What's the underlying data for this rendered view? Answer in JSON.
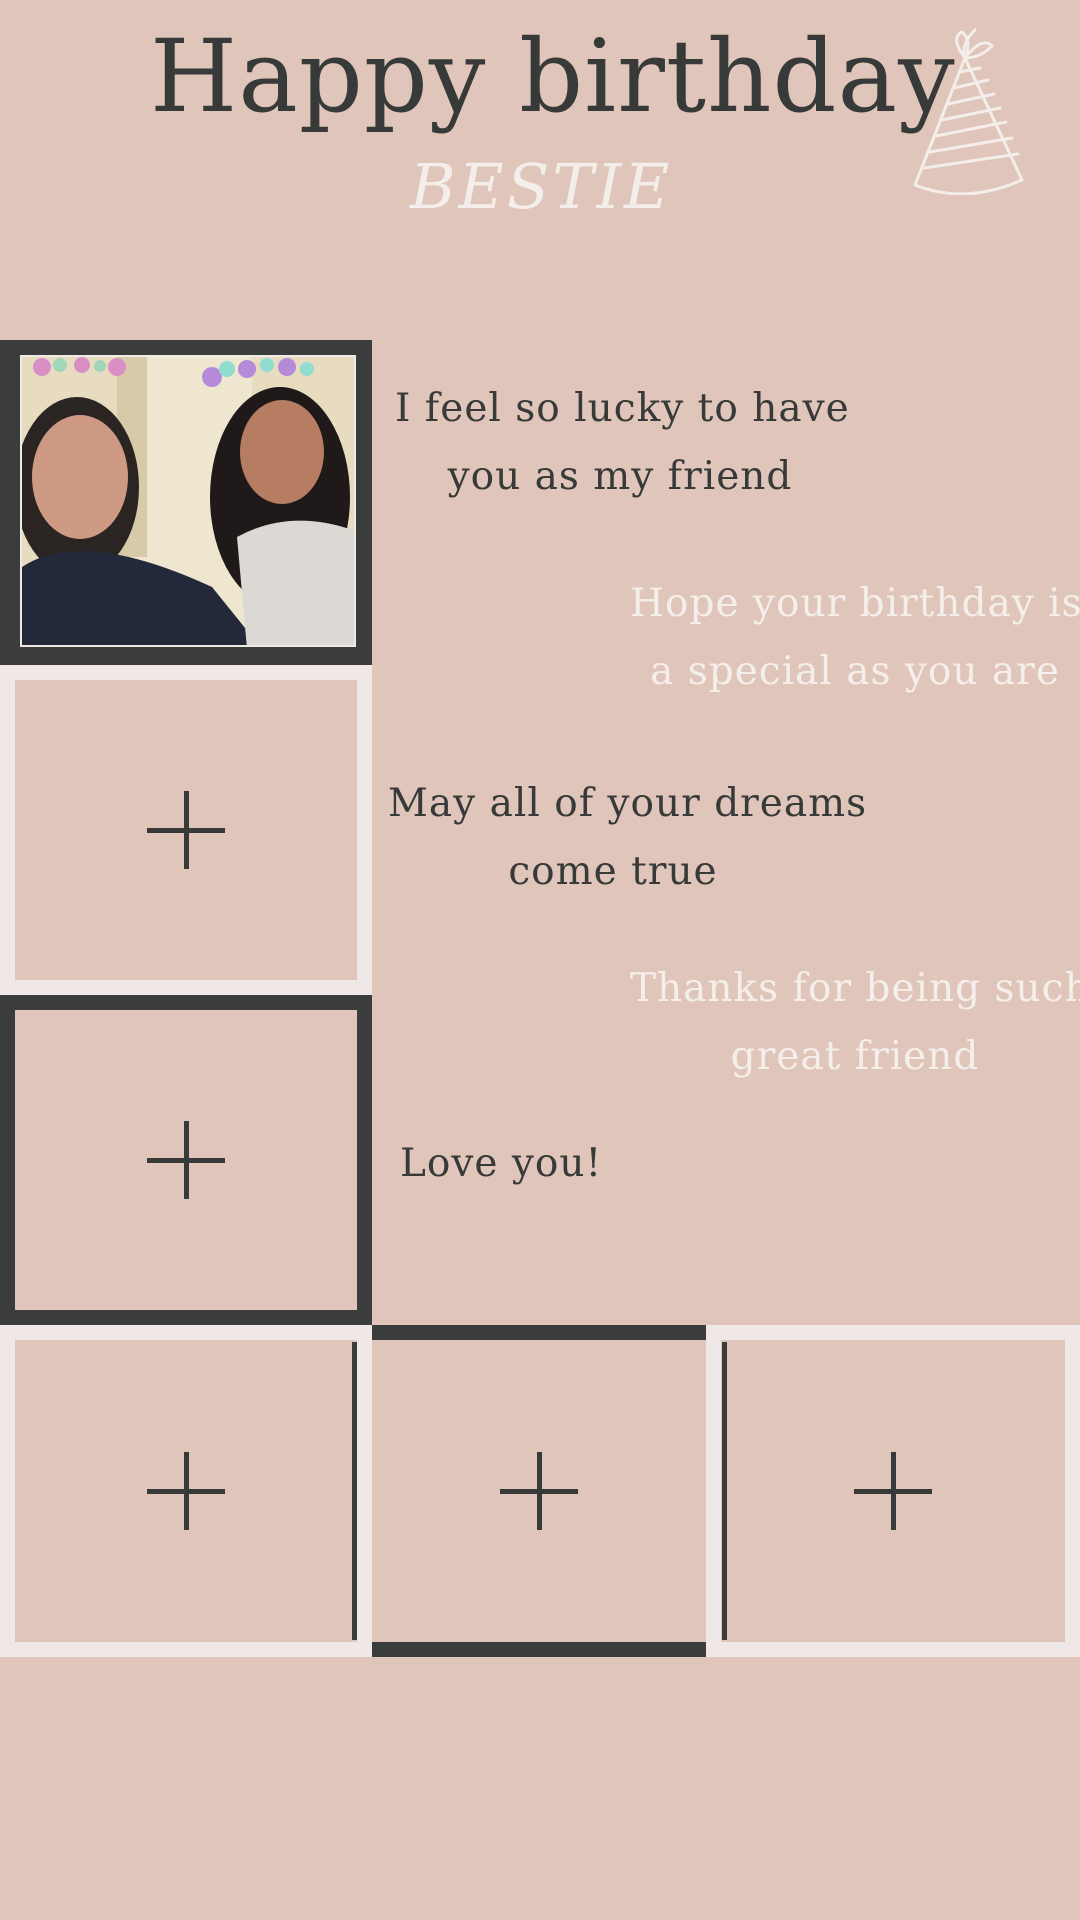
{
  "header": {
    "title": "Happy birthday",
    "subtitle": "BESTIE",
    "icon": "party-hat-icon"
  },
  "messages": [
    {
      "line1": "I feel so lucky to have",
      "line2": "you as my friend"
    },
    {
      "line1": "Hope your birthday is",
      "line2": "a special as you are"
    },
    {
      "line1": "May all of your dreams",
      "line2": "come true"
    },
    {
      "line1": "Thanks for being such",
      "line2": "great friend"
    },
    {
      "line1": "Love you!"
    }
  ],
  "photo_slots": {
    "add_icon": "plus-icon",
    "colors": {
      "background": "#e0c5ba",
      "dark_frame": "#3a3d3b",
      "light_frame": "#efe8e6",
      "text_dark": "#373a38",
      "text_light": "#f5efeb"
    }
  }
}
